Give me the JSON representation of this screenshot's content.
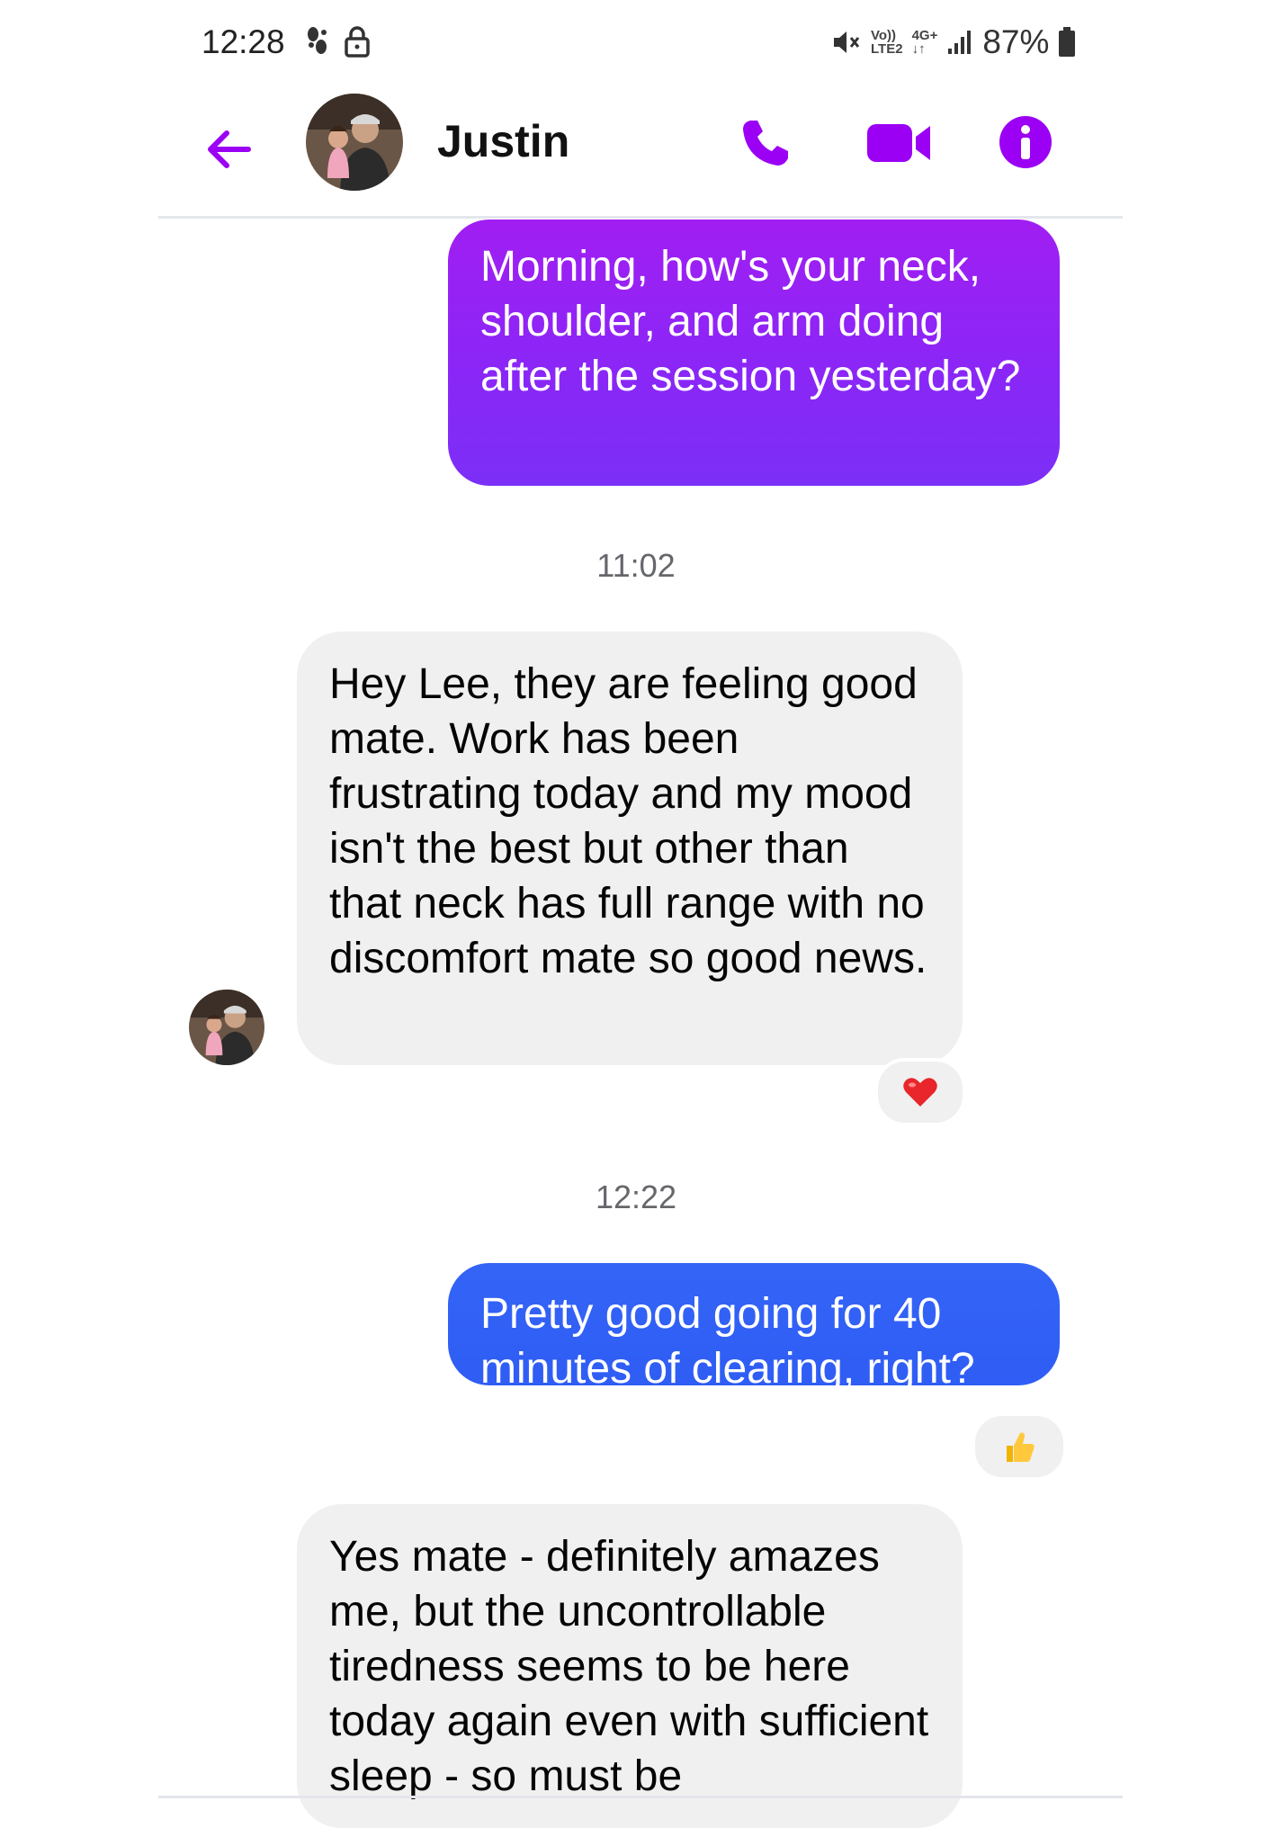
{
  "status_bar": {
    "time": "12:28",
    "network_top": "Vo))",
    "network_bottom": "LTE2",
    "network_type": "4G+",
    "battery": "87%",
    "icons": [
      "steps-icon",
      "lock-icon",
      "mute-icon",
      "signal-icon",
      "battery-icon"
    ]
  },
  "header": {
    "contact_name": "Justin",
    "icons": [
      "back-arrow-icon",
      "phone-icon",
      "video-camera-icon",
      "info-icon"
    ],
    "accent_color": "#9b00f5"
  },
  "messages": [
    {
      "direction": "outgoing",
      "text": "Morning, how's your neck, shoulder, and arm doing after the session yesterday?",
      "bubble_color": "#9a1ff4"
    },
    {
      "direction": "incoming",
      "text": "Hey Lee, they are feeling good mate. Work has been frustrating today and my mood isn't the best but other than that neck has full range with no discomfort mate so good news.",
      "reaction": "❤️"
    },
    {
      "direction": "outgoing",
      "text": "Pretty good going for 40 minutes of clearing, right?",
      "bubble_color": "#3063f6",
      "reaction": "👍"
    },
    {
      "direction": "incoming",
      "text": "Yes mate - definitely amazes me, but the uncontrollable tiredness seems to be here today again even with sufficient sleep - so must be"
    }
  ],
  "timestamps": [
    "11:02",
    "12:22"
  ]
}
